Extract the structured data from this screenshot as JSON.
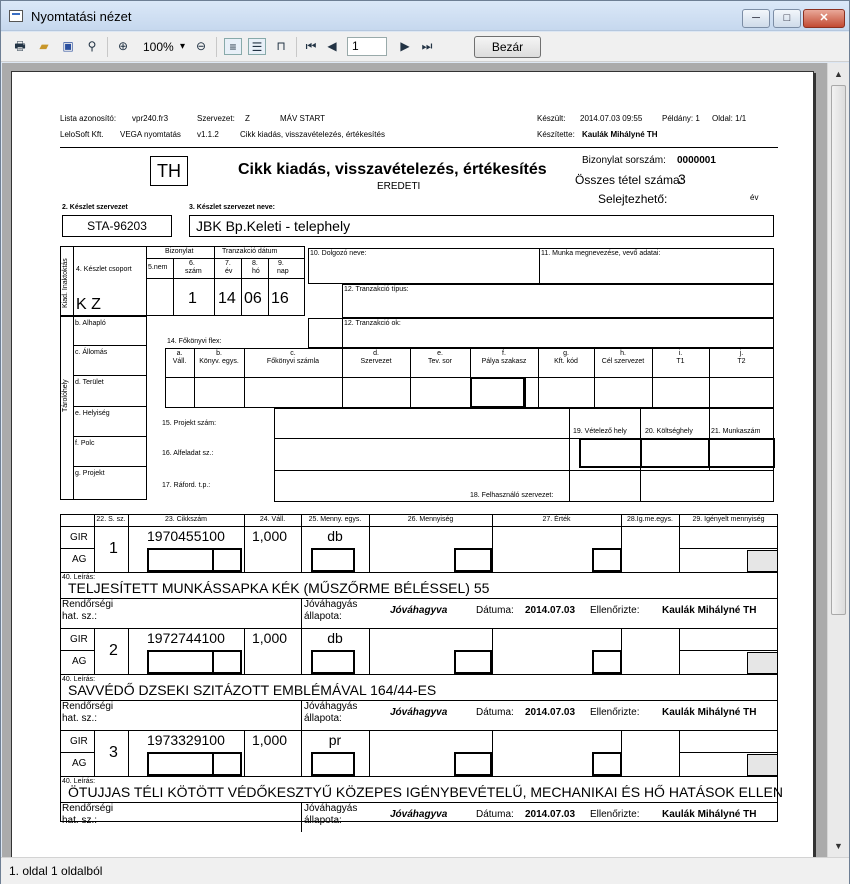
{
  "window": {
    "title": "Nyomtatási nézet",
    "min": "─",
    "max": "□",
    "close": "✕"
  },
  "toolbar": {
    "zoom": "100%",
    "page": "1",
    "close_label": "Bezár"
  },
  "status": "1. oldal 1 oldalból",
  "doc": {
    "hdr": {
      "lista_label": "Lista azonosító:",
      "lista_value": "vpr240.fr3",
      "szervezet_label": "Szervezet:",
      "szervezet_code": "Z",
      "szervezet_name": "MÁV START",
      "vendor": "LeloSoft Kft.",
      "app": "VEGA nyomtatás",
      "version": "v1.1.2",
      "subtitle": "Cikk kiadás, visszavételezés, értékesítés",
      "keszult_label": "Készült:",
      "keszult_value": "2014.07.03 09:55",
      "peldany": "Példány: 1",
      "oldal": "Oldal: 1/1",
      "keszitette_label": "Készítette:",
      "keszitette_value": "Kaulák Mihályné TH"
    },
    "th": "TH",
    "title": "Cikk kiadás, visszavételezés, értékesítés",
    "eredeti": "EREDETI",
    "bizonylat_label": "Bizonylat sorszám:",
    "bizonylat_value": "0000001",
    "osszes_label": "Összes tétel száma:",
    "osszes_value": "3",
    "selejt_label": "Selejtezhető:",
    "ev": "év",
    "k2_label": "2. Készlet szervezet",
    "k2_value": "STA-96203",
    "k3_label": "3. Készlet szervezet neve:",
    "k3_value": "JBK Bp.Keleti - telephely",
    "kiad": "Kiad. Inaktoktás",
    "csoport_label": "4. Készlet csoport",
    "csoport_value": "K Z",
    "bizonylat_hdr": "Bizonylat",
    "snem": "5.nem",
    "szam6": "6.",
    "szam6b": "szám",
    "bizonylat_num": "1",
    "tranz_hdr": "Tranzakció dátum",
    "d7": "7.",
    "d7b": "év",
    "d8": "8.",
    "d8b": "hó",
    "d9": "9.",
    "d9b": "nap",
    "ev_val": "14",
    "ho_val": "06",
    "nap_val": "16",
    "f10": "10. Dolgozó neve:",
    "f11": "11. Munka megnevezése, vevő adatai:",
    "f12a": "12. Tranzakció típus:",
    "f12b": "12. Tranzakció ok:",
    "tarolo": "Tárolóhely",
    "b_alap": "b. Alhapló",
    "c_allomas": "c. Állomás",
    "d_terulet": "d. Terület",
    "e_hely": "e. Helyiség",
    "f_polc": "f. Polc",
    "g_proj": "g. Projekt",
    "f14": "14. Főkönyvi flex:",
    "cols": [
      {
        "l": "a.",
        "l2": "Váll."
      },
      {
        "l": "b.",
        "l2": "Könyv. egys."
      },
      {
        "l": "c.",
        "l2": "Főkönyvi számla"
      },
      {
        "l": "d.",
        "l2": "Szervezet"
      },
      {
        "l": "e.",
        "l2": "Tev. sor"
      },
      {
        "l": "f.",
        "l2": "Pálya szakasz"
      },
      {
        "l": "g.",
        "l2": "Kft. kód"
      },
      {
        "l": "h.",
        "l2": "Cél szervezet"
      },
      {
        "l": "i.",
        "l2": "T1"
      },
      {
        "l": "j.",
        "l2": "T2"
      }
    ],
    "f15": "15. Projekt szám:",
    "f16": "16. Alfeladat sz.:",
    "f17": "17. Ráford. t.p.:",
    "f18": "18. Felhasználó szervezet:",
    "f19": "19. Vételező hely",
    "f20": "20. Költséghely",
    "f21": "21. Munkaszám",
    "ih": {
      "sz": "22. S. sz.",
      "cikk": "23. Cikkszám",
      "vall": "24. Váll.",
      "menny": "25. Menny. egys.",
      "mennyiseg": "26. Mennyiség",
      "ertek": "27. Érték",
      "ig": "28.Ig.me.egys.",
      "igeny": "29. Igényelt mennyiség"
    },
    "gir": "GIR",
    "ag": "AG",
    "leiras": "40. Leírás:",
    "rendor": "Rendőrségi",
    "hat": "hat. sz.:",
    "jov1": "Jóváhagyás",
    "jov2": "állapota:",
    "jov_val": "Jóváhagyva",
    "datuma": "Dátuma:",
    "ellenorizte": "Ellenőrizte:",
    "items": [
      {
        "no": "1",
        "cikk": "1970455100",
        "vall": "1,000",
        "egys": "db",
        "desc": "TELJESÍTETT MUNKÁSSAPKA KÉK (MŰSZŐRME BÉLÉSSEL) 55",
        "date": "2014.07.03",
        "by": "Kaulák Mihályné TH"
      },
      {
        "no": "2",
        "cikk": "1972744100",
        "vall": "1,000",
        "egys": "db",
        "desc": "SAVVÉDŐ DZSEKI SZITÁZOTT EMBLÉMÁVAL 164/44-ES",
        "date": "2014.07.03",
        "by": "Kaulák Mihályné TH"
      },
      {
        "no": "3",
        "cikk": "1973329100",
        "vall": "1,000",
        "egys": "pr",
        "desc": "ÖTUJJAS TÉLI KÖTÖTT VÉDŐKESZTYŰ KÖZEPES IGÉNYBEVÉTELŰ, MECHANIKAI ÉS HŐ HATÁSOK ELLEN",
        "date": "2014.07.03",
        "by": "Kaulák Mihályné TH"
      }
    ]
  }
}
